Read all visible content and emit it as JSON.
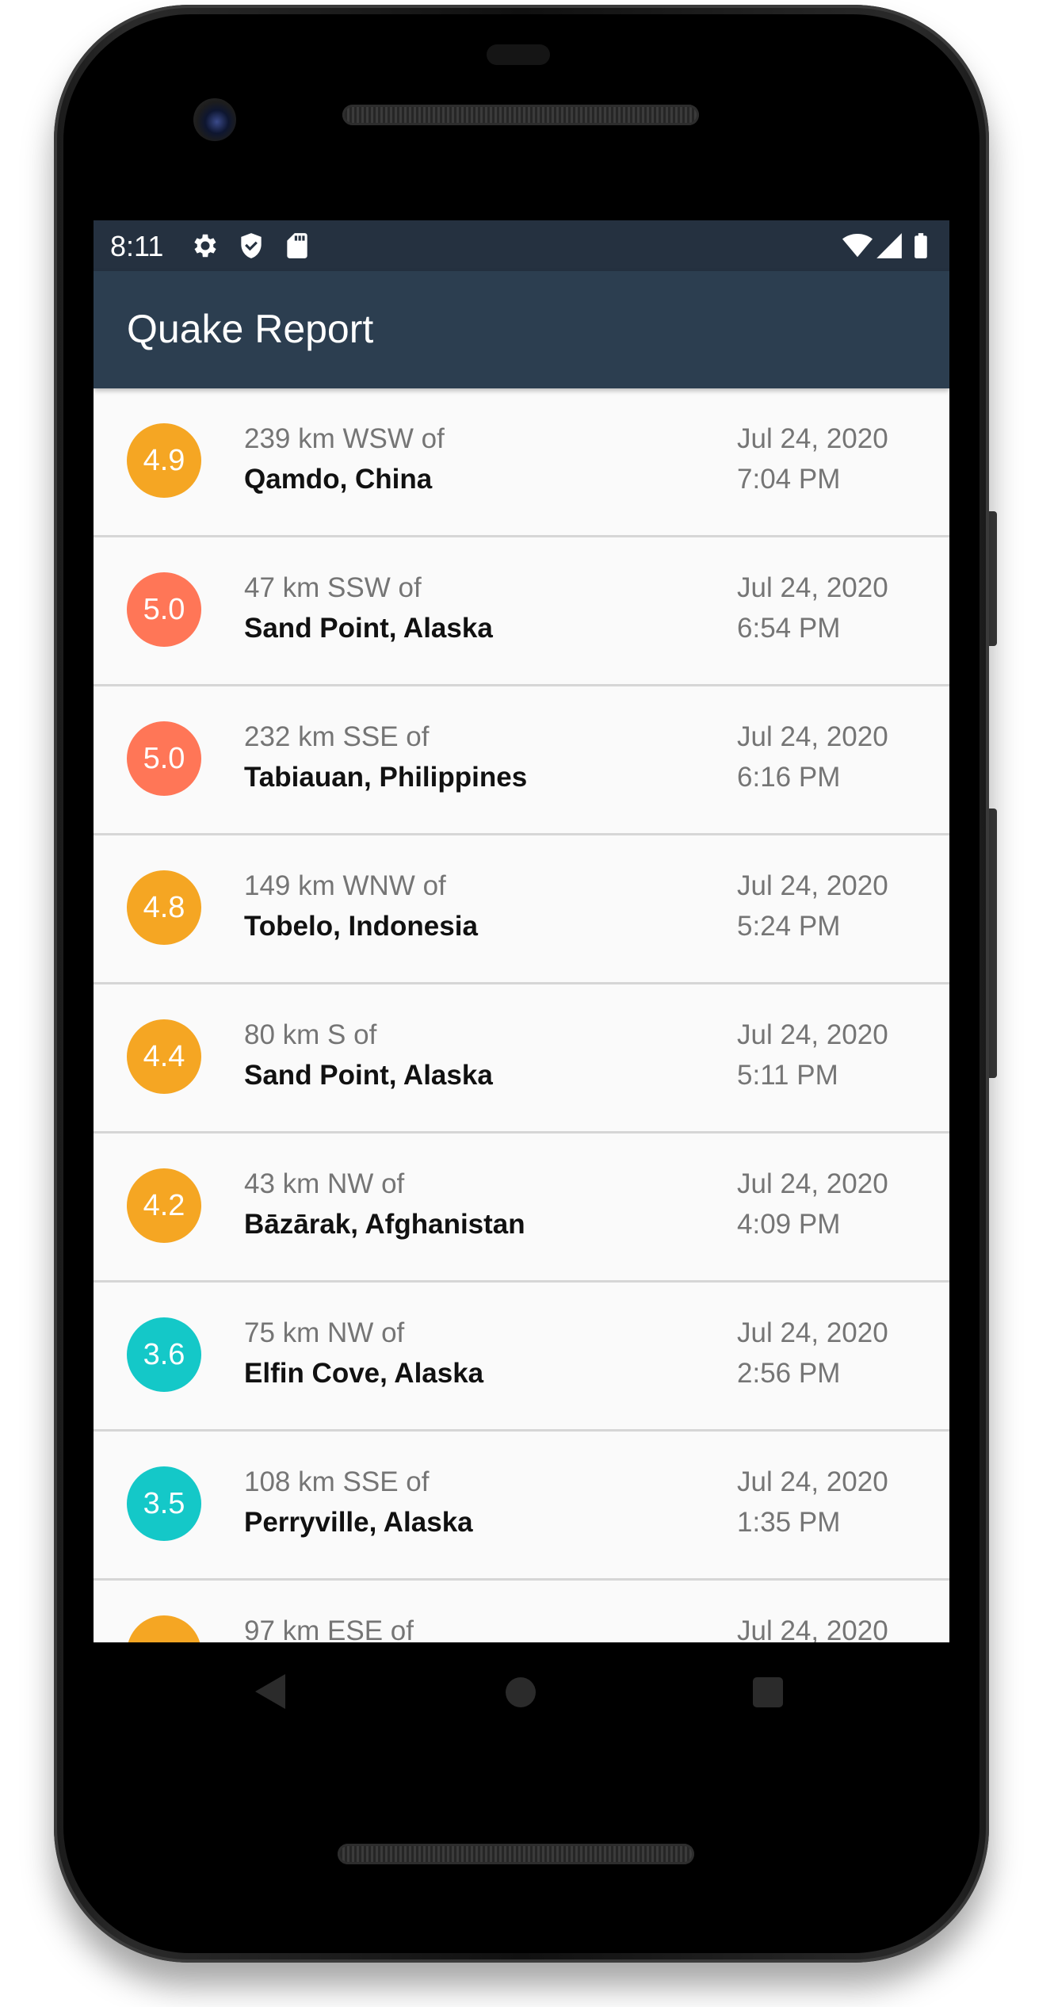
{
  "status_bar": {
    "time": "8:11",
    "icons": [
      "gear-icon",
      "shield-icon",
      "sd-card-icon",
      "wifi-icon",
      "signal-icon",
      "battery-icon"
    ]
  },
  "app_bar": {
    "title": "Quake Report"
  },
  "colors": {
    "status_bar": "#253140",
    "app_bar": "#2c3e50",
    "mag_orange": "#f5a623",
    "mag_coral": "#ff7657",
    "mag_teal": "#14c8c8"
  },
  "earthquakes": [
    {
      "magnitude": "4.9",
      "offset": "239 km WSW of",
      "place": "Qamdo, China",
      "date": "Jul 24, 2020",
      "time": "7:04 PM",
      "color": "#f5a623"
    },
    {
      "magnitude": "5.0",
      "offset": "47 km SSW of",
      "place": "Sand Point, Alaska",
      "date": "Jul 24, 2020",
      "time": "6:54 PM",
      "color": "#ff7657"
    },
    {
      "magnitude": "5.0",
      "offset": "232 km SSE of",
      "place": "Tabiauan, Philippines",
      "date": "Jul 24, 2020",
      "time": "6:16 PM",
      "color": "#ff7657"
    },
    {
      "magnitude": "4.8",
      "offset": "149 km WNW of",
      "place": "Tobelo, Indonesia",
      "date": "Jul 24, 2020",
      "time": "5:24 PM",
      "color": "#f5a623"
    },
    {
      "magnitude": "4.4",
      "offset": "80 km S of",
      "place": "Sand Point, Alaska",
      "date": "Jul 24, 2020",
      "time": "5:11 PM",
      "color": "#f5a623"
    },
    {
      "magnitude": "4.2",
      "offset": "43 km NW of",
      "place": "Bāzārak, Afghanistan",
      "date": "Jul 24, 2020",
      "time": "4:09 PM",
      "color": "#f5a623"
    },
    {
      "magnitude": "3.6",
      "offset": "75 km NW of",
      "place": "Elfin Cove, Alaska",
      "date": "Jul 24, 2020",
      "time": "2:56 PM",
      "color": "#14c8c8"
    },
    {
      "magnitude": "3.5",
      "offset": "108 km SSE of",
      "place": "Perryville, Alaska",
      "date": "Jul 24, 2020",
      "time": "1:35 PM",
      "color": "#14c8c8"
    },
    {
      "magnitude": "",
      "offset": "97 km ESE of",
      "place": "",
      "date": "Jul 24, 2020",
      "time": "",
      "color": "#f5a623"
    }
  ]
}
